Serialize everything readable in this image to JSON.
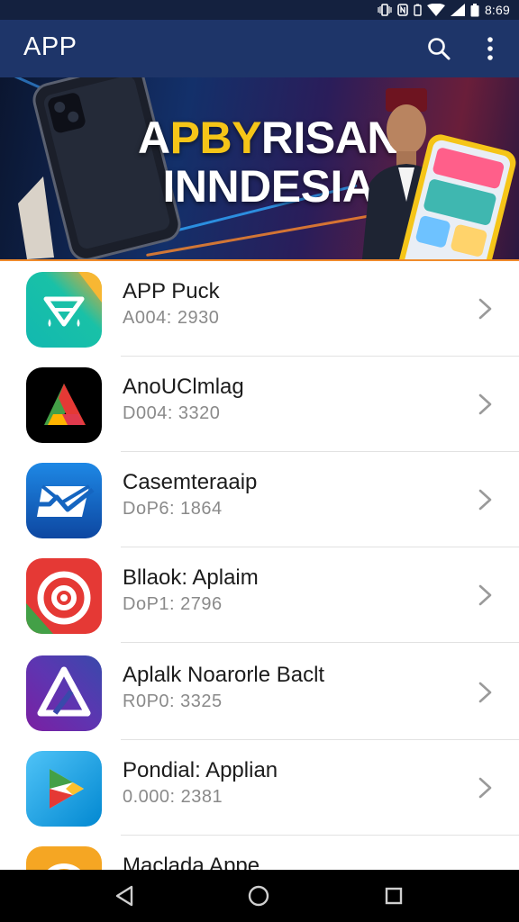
{
  "status_bar": {
    "time": "8:69",
    "icons": [
      "vibrate-icon",
      "nfc-icon",
      "battery-saver-icon",
      "wifi-icon",
      "signal-icon",
      "battery-icon"
    ]
  },
  "app_bar": {
    "title": "APP",
    "actions": [
      "search-icon",
      "more-vert-icon"
    ]
  },
  "banner": {
    "title_prefix": "A",
    "title_highlight": "PBY",
    "title_suffix": "RISAN",
    "title_line2": "INNDESIA",
    "colors": {
      "highlight": "#f5c518",
      "accent_line": "#f08b2c"
    }
  },
  "apps": [
    {
      "name": "APP Puck",
      "meta": "A004: 2930",
      "icon": "triangle-drops-icon",
      "colors": [
        "#19c1a7",
        "#f2a62b"
      ]
    },
    {
      "name": "AnoUClmlag",
      "meta": "D004: 3320",
      "icon": "colorful-a-icon",
      "colors": [
        "#000000",
        "#e53935",
        "#43a047",
        "#ffb300"
      ]
    },
    {
      "name": "Casemteraaip",
      "meta": "DoP6: 1864",
      "icon": "envelope-check-icon",
      "colors": [
        "#1565c0",
        "#ffffff"
      ]
    },
    {
      "name": "Bllaok: Aplaim",
      "meta": "DoP1: 2796",
      "icon": "target-icon",
      "colors": [
        "#e53935",
        "#43a047"
      ]
    },
    {
      "name": "Aplalk Noarorle Baclt",
      "meta": "R0P0: 3325",
      "icon": "triangle-a-icon",
      "colors": [
        "#3949ab",
        "#8e24aa"
      ]
    },
    {
      "name": "Pondial: Applian",
      "meta": "0.000: 2381",
      "icon": "play-store-icon",
      "colors": [
        "#29b6f6",
        "#e53935",
        "#fbc02d"
      ]
    },
    {
      "name": "Maclada Appe",
      "meta": "",
      "icon": "clock-icon",
      "colors": [
        "#f5a623"
      ]
    }
  ],
  "nav_bar": {
    "buttons": [
      "back-icon",
      "home-icon",
      "recents-icon"
    ]
  }
}
